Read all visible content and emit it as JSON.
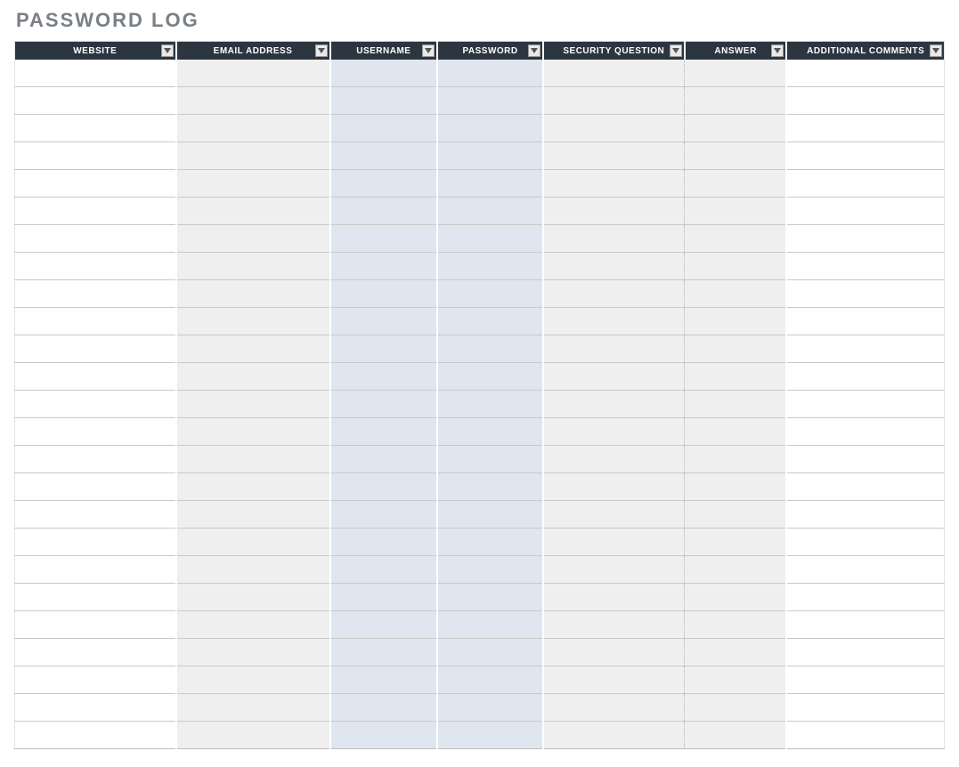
{
  "title": "PASSWORD LOG",
  "columns": {
    "website": {
      "label": "WEBSITE"
    },
    "email": {
      "label": "EMAIL ADDRESS"
    },
    "username": {
      "label": "USERNAME"
    },
    "password": {
      "label": "PASSWORD"
    },
    "secq": {
      "label": "SECURITY QUESTION"
    },
    "answer": {
      "label": "ANSWER"
    },
    "comments": {
      "label": "ADDITIONAL COMMENTS"
    }
  },
  "rows": [
    {
      "website": "",
      "email": "",
      "username": "",
      "password": "",
      "secq": "",
      "answer": "",
      "comments": ""
    },
    {
      "website": "",
      "email": "",
      "username": "",
      "password": "",
      "secq": "",
      "answer": "",
      "comments": ""
    },
    {
      "website": "",
      "email": "",
      "username": "",
      "password": "",
      "secq": "",
      "answer": "",
      "comments": ""
    },
    {
      "website": "",
      "email": "",
      "username": "",
      "password": "",
      "secq": "",
      "answer": "",
      "comments": ""
    },
    {
      "website": "",
      "email": "",
      "username": "",
      "password": "",
      "secq": "",
      "answer": "",
      "comments": ""
    },
    {
      "website": "",
      "email": "",
      "username": "",
      "password": "",
      "secq": "",
      "answer": "",
      "comments": ""
    },
    {
      "website": "",
      "email": "",
      "username": "",
      "password": "",
      "secq": "",
      "answer": "",
      "comments": ""
    },
    {
      "website": "",
      "email": "",
      "username": "",
      "password": "",
      "secq": "",
      "answer": "",
      "comments": ""
    },
    {
      "website": "",
      "email": "",
      "username": "",
      "password": "",
      "secq": "",
      "answer": "",
      "comments": ""
    },
    {
      "website": "",
      "email": "",
      "username": "",
      "password": "",
      "secq": "",
      "answer": "",
      "comments": ""
    },
    {
      "website": "",
      "email": "",
      "username": "",
      "password": "",
      "secq": "",
      "answer": "",
      "comments": ""
    },
    {
      "website": "",
      "email": "",
      "username": "",
      "password": "",
      "secq": "",
      "answer": "",
      "comments": ""
    },
    {
      "website": "",
      "email": "",
      "username": "",
      "password": "",
      "secq": "",
      "answer": "",
      "comments": ""
    },
    {
      "website": "",
      "email": "",
      "username": "",
      "password": "",
      "secq": "",
      "answer": "",
      "comments": ""
    },
    {
      "website": "",
      "email": "",
      "username": "",
      "password": "",
      "secq": "",
      "answer": "",
      "comments": ""
    },
    {
      "website": "",
      "email": "",
      "username": "",
      "password": "",
      "secq": "",
      "answer": "",
      "comments": ""
    },
    {
      "website": "",
      "email": "",
      "username": "",
      "password": "",
      "secq": "",
      "answer": "",
      "comments": ""
    },
    {
      "website": "",
      "email": "",
      "username": "",
      "password": "",
      "secq": "",
      "answer": "",
      "comments": ""
    },
    {
      "website": "",
      "email": "",
      "username": "",
      "password": "",
      "secq": "",
      "answer": "",
      "comments": ""
    },
    {
      "website": "",
      "email": "",
      "username": "",
      "password": "",
      "secq": "",
      "answer": "",
      "comments": ""
    },
    {
      "website": "",
      "email": "",
      "username": "",
      "password": "",
      "secq": "",
      "answer": "",
      "comments": ""
    },
    {
      "website": "",
      "email": "",
      "username": "",
      "password": "",
      "secq": "",
      "answer": "",
      "comments": ""
    },
    {
      "website": "",
      "email": "",
      "username": "",
      "password": "",
      "secq": "",
      "answer": "",
      "comments": ""
    },
    {
      "website": "",
      "email": "",
      "username": "",
      "password": "",
      "secq": "",
      "answer": "",
      "comments": ""
    },
    {
      "website": "",
      "email": "",
      "username": "",
      "password": "",
      "secq": "",
      "answer": "",
      "comments": ""
    }
  ]
}
